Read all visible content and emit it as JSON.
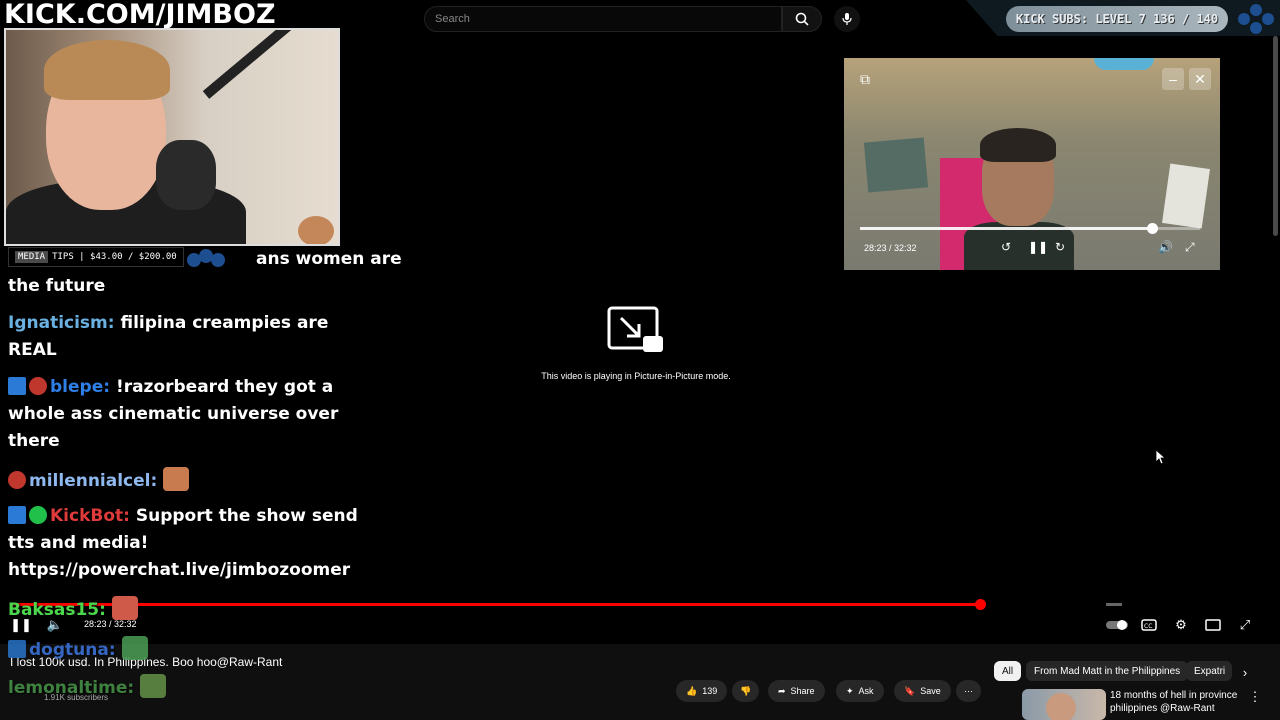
{
  "overlay": {
    "banner": "KICK.COM/JIMBOZ",
    "media_label": "MEDIA",
    "tips": "TIPS | $43.00 / $200.00",
    "kick_subs": "KICK SUBS: LEVEL 7 136 / 140"
  },
  "chat": {
    "lines": [
      {
        "text": "ans women are"
      },
      {
        "text": "the future"
      },
      {
        "user": "Ignaticism:",
        "text": " filipina creampies are"
      },
      {
        "text": "REAL"
      },
      {
        "user": "blepe:",
        "text": " !razorbeard they got a"
      },
      {
        "text": "whole ass cinematic universe over"
      },
      {
        "text": "there"
      },
      {
        "user": "millennialcel:",
        "text": ""
      },
      {
        "user": "KickBot:",
        "text": " Support the show send"
      },
      {
        "text": "tts and media!"
      },
      {
        "text": "https://powerchat.live/jimbozoomer"
      },
      {
        "user": "Baksas15:",
        "text": ""
      },
      {
        "user": "dogtuna:",
        "text": ""
      },
      {
        "user": "lemonaltime:",
        "text": ""
      }
    ],
    "colors": {
      "ignaticism": "#6ab0e0",
      "blepe": "#2f7fe8",
      "millennialcel": "#8fb8ee",
      "kickbot": "#e03b3b",
      "baksas": "#4cd64c",
      "dogtuna": "#3f7ef0",
      "lemon": "#4c9e4c"
    }
  },
  "youtube": {
    "search_placeholder": "Search",
    "pip_message": "This video is playing in Picture-in-Picture mode.",
    "time": "28:23 / 32:32",
    "progress": 0.872,
    "title": "I lost 100k usd. In Philippines. Boo hoo@Raw-Rant",
    "subscribers": "1.91K subscribers",
    "likes": "139",
    "share_label": "Share",
    "ask_label": "Ask",
    "save_label": "Save",
    "chips": [
      "All",
      "From Mad Matt in the Philippines",
      "Expatri"
    ],
    "recommendation": "18 months of hell in province philippines @Raw-Rant"
  },
  "pip": {
    "time": "28:23 / 32:32",
    "progress": 0.86
  },
  "icons": [
    "search-icon",
    "mic-icon",
    "pip-icon",
    "close-icon",
    "minimize-icon",
    "pause-icon",
    "volume-icon",
    "settings-icon",
    "captions-icon",
    "fullscreen-icon",
    "like-icon",
    "dislike-icon",
    "share-icon",
    "ask-icon",
    "save-icon",
    "more-icon"
  ]
}
